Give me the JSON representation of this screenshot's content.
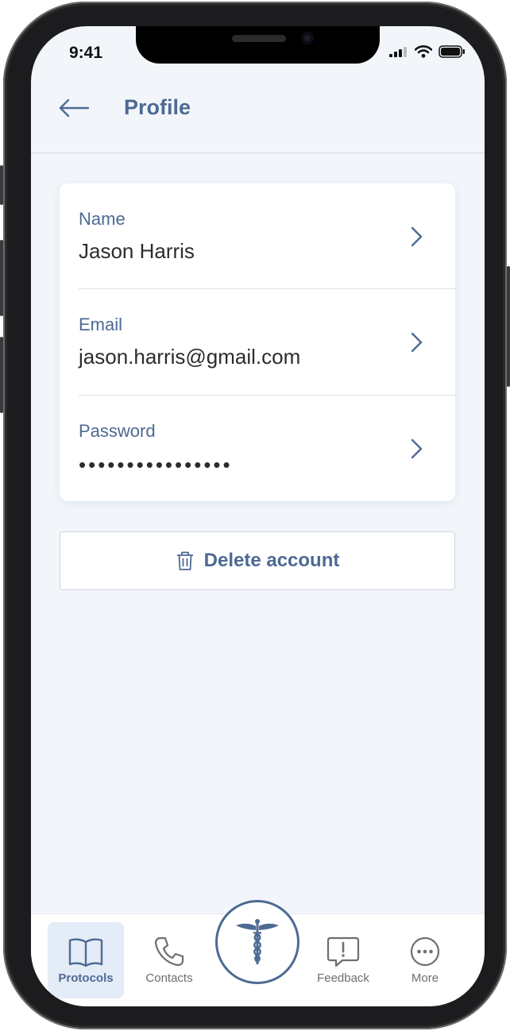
{
  "status_bar": {
    "time": "9:41"
  },
  "header": {
    "title": "Profile"
  },
  "profile": {
    "rows": [
      {
        "label": "Name",
        "value": "Jason Harris"
      },
      {
        "label": "Email",
        "value": "jason.harris@gmail.com"
      },
      {
        "label": "Password",
        "value": "••••••••••••••••"
      }
    ]
  },
  "actions": {
    "delete_label": "Delete account"
  },
  "tabbar": {
    "tabs": [
      {
        "label": "Protocols",
        "icon": "book-icon",
        "active": true
      },
      {
        "label": "Contacts",
        "icon": "phone-icon",
        "active": false
      },
      {
        "label": "",
        "icon": "caduceus-icon",
        "active": false
      },
      {
        "label": "Feedback",
        "icon": "feedback-icon",
        "active": false
      },
      {
        "label": "More",
        "icon": "more-icon",
        "active": false
      }
    ]
  },
  "colors": {
    "accent": "#4d6a93",
    "background": "#f2f6fb",
    "text": "#2c2c2c"
  }
}
